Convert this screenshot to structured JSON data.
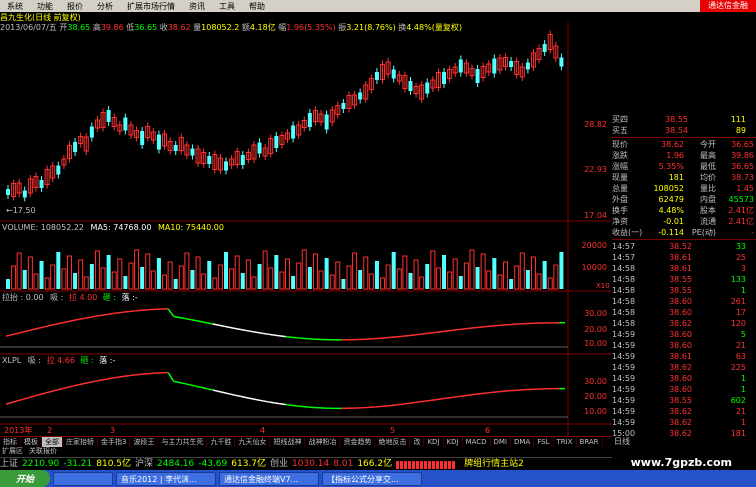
{
  "menubar": {
    "items": [
      "系统",
      "功能",
      "报价",
      "分析",
      "扩展市场行情",
      "资讯",
      "工具",
      "帮助"
    ],
    "brand": "通达信金融"
  },
  "stock": {
    "title": "昌九生化(日线 前复权)",
    "date": "2013/06/07/五",
    "open_label": "开",
    "open": "38.65",
    "high_label": "高",
    "high": "39.86",
    "low_label": "低",
    "low": "36.65",
    "close_label": "收",
    "close": "38.62",
    "vol_label": "量",
    "vol": "108052.2",
    "amount_label": "额",
    "amount": "4.18亿",
    "change_label": "幅",
    "change": "1.96(5.35%)",
    "amp_label": "振",
    "amp": "3.21(8.76%)",
    "turnover_label": "换",
    "turnover": "4.48%(量复权)",
    "min_marker": "←17.50"
  },
  "price_axis": [
    "28.82",
    "22.93",
    "17.04"
  ],
  "volume_axis": [
    "20000",
    "10000"
  ],
  "volume_info": {
    "label": "VOLUME: 108052.22",
    "ma5": "MA5: 74768.00",
    "ma10": "MA10: 75440.00",
    "x_label": "X10"
  },
  "ind1": {
    "title": "拉抬 : 0.00",
    "tag1": "吸 :",
    "tag2": "拉 4.00",
    "tag3": "砸 :",
    "tag4": "落 :-",
    "axis": [
      "30.00",
      "20.00",
      "10.00"
    ]
  },
  "ind2": {
    "title": "XLPL",
    "tag1": "吸 :",
    "tag2": "拉 4.66",
    "tag3": "砸 :",
    "tag4": "落 :-",
    "axis": [
      "30.00",
      "20.00",
      "10.00"
    ]
  },
  "time_axis": [
    "2013年",
    "2",
    "3",
    "4",
    "5",
    "6"
  ],
  "quote": {
    "buy4_label": "买四",
    "buy4_price": "38.55",
    "buy4_vol": "111",
    "buy5_label": "买五",
    "buy5_price": "38.54",
    "buy5_vol": "89",
    "rows": [
      {
        "l1": "现价",
        "v1": "38.62",
        "l2": "今开",
        "v2": "36.65"
      },
      {
        "l1": "涨跌",
        "v1": "1.96",
        "l2": "最高",
        "v2": "39.86"
      },
      {
        "l1": "涨幅",
        "v1": "5.35%",
        "l2": "最低",
        "v2": "36.65"
      },
      {
        "l1": "现量",
        "v1": "181",
        "l2": "均价",
        "v2": "38.73"
      },
      {
        "l1": "总量",
        "v1": "108052",
        "l2": "量比",
        "v2": "1.45"
      },
      {
        "l1": "外盘",
        "v1": "62479",
        "l2": "内盘",
        "v2": "45573"
      },
      {
        "l1": "换手",
        "v1": "4.48%",
        "l2": "股本",
        "v2": "2.41亿"
      },
      {
        "l1": "净资",
        "v1": "-0.01",
        "l2": "流通",
        "v2": "2.41亿"
      },
      {
        "l1": "收益(一)",
        "v1": "-0.114",
        "l2": "PE(动)",
        "v2": "-"
      }
    ]
  },
  "ticks": [
    {
      "t": "14:57",
      "p": "38.52",
      "v": "33",
      "c": "#00ff00"
    },
    {
      "t": "14:57",
      "p": "38.61",
      "v": "25",
      "c": "#ff3030"
    },
    {
      "t": "14:58",
      "p": "38.61",
      "v": "3",
      "c": "#ff3030"
    },
    {
      "t": "14:58",
      "p": "38.55",
      "v": "133",
      "c": "#00ff00"
    },
    {
      "t": "14:58",
      "p": "38.55",
      "v": "1",
      "c": "#00ff00"
    },
    {
      "t": "14:58",
      "p": "38.60",
      "v": "261",
      "c": "#ff3030"
    },
    {
      "t": "14:58",
      "p": "38.60",
      "v": "17",
      "c": "#ff3030"
    },
    {
      "t": "14:58",
      "p": "38.62",
      "v": "120",
      "c": "#ff3030"
    },
    {
      "t": "14:59",
      "p": "38.60",
      "v": "5",
      "c": "#00ff00"
    },
    {
      "t": "14:59",
      "p": "38.60",
      "v": "21",
      "c": "#ff3030"
    },
    {
      "t": "14:59",
      "p": "38.61",
      "v": "63",
      "c": "#ff3030"
    },
    {
      "t": "14:59",
      "p": "38.62",
      "v": "225",
      "c": "#ff3030"
    },
    {
      "t": "14:59",
      "p": "38.60",
      "v": "1",
      "c": "#00ff00"
    },
    {
      "t": "14:59",
      "p": "38.60",
      "v": "1",
      "c": "#00ff00"
    },
    {
      "t": "14:59",
      "p": "38.55",
      "v": "602",
      "c": "#00ff00"
    },
    {
      "t": "14:59",
      "p": "38.62",
      "v": "21",
      "c": "#ff3030"
    },
    {
      "t": "14:59",
      "p": "38.62",
      "v": "1",
      "c": "#ff3030"
    },
    {
      "t": "15:00",
      "p": "38.62",
      "v": "181",
      "c": "#ff3030"
    }
  ],
  "tabs": [
    "指标",
    "模板",
    "全部",
    "庄家抬轿",
    "金手指3",
    "波段王",
    "与主力共生死",
    "九千胜",
    "九天仙女",
    "短线战神",
    "战神粉冶",
    "资金趋势",
    "绝地反击",
    "改",
    "KDJ",
    "KDJ",
    "MACD",
    "DMI",
    "DMA",
    "FSL",
    "TRIX",
    "BRAR"
  ],
  "active_tab": "全部",
  "right_tab": "日线",
  "subtabs": [
    "扩展区",
    "关联报价"
  ],
  "ticker": {
    "sh_label": "上证",
    "sh_val": "2210.90",
    "sh_chg": "-31.21",
    "sh_amt": "810.5亿",
    "sz_label": "沪深",
    "sz_val": "2484.16",
    "sz_chg": "-43.69",
    "sz_amt": "613.7亿",
    "cy_label": "创业",
    "cy_val": "1030.14",
    "cy_chg": "8.01",
    "cy_amt": "166.2亿",
    "main_label": "牌组行情主站2"
  },
  "taskbar": {
    "start": "开始",
    "buttons": [
      "音乐2012 | 李代沫...",
      "通达信金融终端V7...",
      "【指标公式分享交..."
    ]
  },
  "watermark": "www.7gpzb.com",
  "colors": {
    "up": "#ff3030",
    "down": "#54ffff",
    "green": "#00ff00",
    "yellow": "#ffff00",
    "axis_red": "#800000"
  }
}
